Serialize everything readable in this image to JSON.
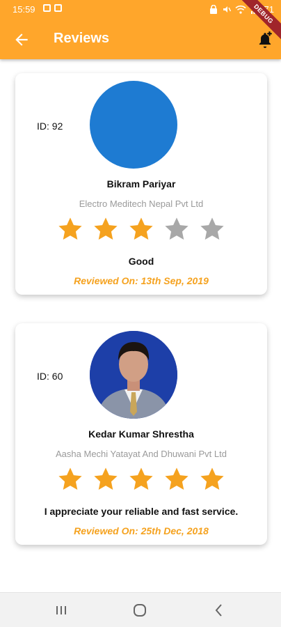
{
  "statusbar": {
    "time": "15:59",
    "battery_text": "71"
  },
  "appbar": {
    "title": "Reviews",
    "back_icon": "arrow-back-icon",
    "action_icon": "add-alert-icon",
    "background_color": "#FFA62B",
    "debug_label": "DEBUG"
  },
  "reviews": [
    {
      "id_label": "ID: 92",
      "name": "Bikram Pariyar",
      "company": "Electro Meditech Nepal Pvt Ltd",
      "rating": 3,
      "rating_max": 5,
      "comment": "Good",
      "date": "Reviewed On: 13th Sep, 2019",
      "avatar": "blue-circle-placeholder"
    },
    {
      "id_label": "ID: 60",
      "name": "Kedar Kumar Shrestha",
      "company": "Aasha Mechi Yatayat And Dhuwani Pvt Ltd",
      "rating": 5,
      "rating_max": 5,
      "comment": "I appreciate your reliable and fast service.",
      "date": "Reviewed On: 25th Dec, 2018",
      "avatar": "person-photo"
    }
  ],
  "colors": {
    "star_filled": "#F5A21F",
    "star_empty": "#A8A8A8",
    "date_text": "#F5A21F"
  },
  "navbar": {
    "recent_icon": "recent-apps-icon",
    "home_icon": "home-icon",
    "back_icon": "nav-back-icon"
  }
}
